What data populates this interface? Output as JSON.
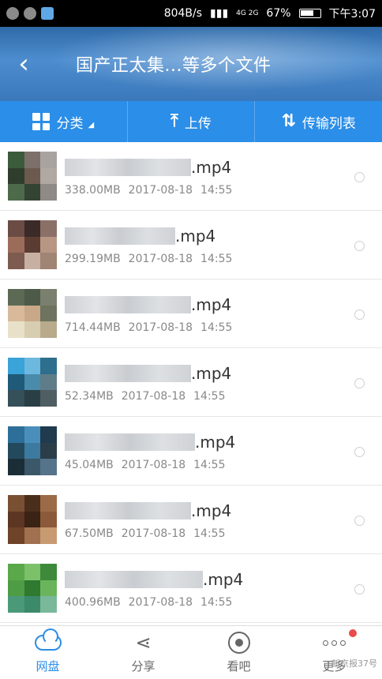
{
  "status_bar": {
    "speed": "804B/s",
    "network": "4G 2G",
    "battery": "67%",
    "time": "下午3:07"
  },
  "header": {
    "back_icon": "chevron-left-icon",
    "title": "国产正太集...等多个文件"
  },
  "toolbar": {
    "category_label": "分类",
    "upload_label": "上传",
    "transfer_label": "传输列表"
  },
  "files": [
    {
      "ext": ".mp4",
      "size": "338.00MB",
      "date": "2017-08-18",
      "time": "14:55",
      "thumb": [
        "#3b5b3a",
        "#7d6f6a",
        "#a9a3a0",
        "#2f3d2c",
        "#6b5a4d",
        "#b0a8a1",
        "#4d6b4a",
        "#344434",
        "#8f8a86"
      ],
      "blur_w": 160
    },
    {
      "ext": ".mp4",
      "size": "299.19MB",
      "date": "2017-08-18",
      "time": "14:55",
      "thumb": [
        "#6a4c44",
        "#3a2b28",
        "#8b7068",
        "#9c6c5a",
        "#5b3c33",
        "#b89684",
        "#7d5b50",
        "#c7b0a2",
        "#a08474"
      ],
      "blur_w": 140
    },
    {
      "ext": ".mp4",
      "size": "714.44MB",
      "date": "2017-08-18",
      "time": "14:55",
      "thumb": [
        "#5c6a55",
        "#4d5a48",
        "#7b7f6e",
        "#d8b99a",
        "#c8a888",
        "#6d735e",
        "#e8e0c8",
        "#d7cdb0",
        "#b9aa8c"
      ],
      "blur_w": 160
    },
    {
      "ext": ".mp4",
      "size": "52.34MB",
      "date": "2017-08-18",
      "time": "14:55",
      "thumb": [
        "#3aa3d8",
        "#6cb8de",
        "#2d6f8c",
        "#1f5a78",
        "#4a8bab",
        "#5f7d88",
        "#36505a",
        "#2a3e46",
        "#4f5e62"
      ],
      "blur_w": 160
    },
    {
      "ext": ".mp4",
      "size": "45.04MB",
      "date": "2017-08-18",
      "time": "14:55",
      "thumb": [
        "#2e6f9a",
        "#4a8fbc",
        "#1f3b4d",
        "#234a5c",
        "#3c7aa0",
        "#2b3d48",
        "#1b2e38",
        "#3a5868",
        "#55738a"
      ],
      "blur_w": 165
    },
    {
      "ext": ".mp4",
      "size": "67.50MB",
      "date": "2017-08-18",
      "time": "14:55",
      "thumb": [
        "#7a5033",
        "#4a2e1c",
        "#9b6a46",
        "#5c3622",
        "#3a2214",
        "#8a5a3a",
        "#6e4328",
        "#a07050",
        "#c79a72"
      ],
      "blur_w": 160
    },
    {
      "ext": ".mp4",
      "size": "400.96MB",
      "date": "2017-08-18",
      "time": "14:55",
      "thumb": [
        "#5aa84a",
        "#7cc06a",
        "#3e8a3a",
        "#4f9c46",
        "#2f7a30",
        "#6ab45c",
        "#4a9a7a",
        "#3c8a6a",
        "#7ab89a"
      ],
      "blur_w": 175
    }
  ],
  "bottom_nav": [
    {
      "label": "网盘",
      "icon": "cloud-icon"
    },
    {
      "label": "分享",
      "icon": "share-icon"
    },
    {
      "label": "看吧",
      "icon": "eye-icon"
    },
    {
      "label": "更多",
      "icon": "more-icon"
    }
  ],
  "watermark": "新京报37号",
  "colors": {
    "accent": "#2b8ee8",
    "badge": "#e94b4b"
  }
}
